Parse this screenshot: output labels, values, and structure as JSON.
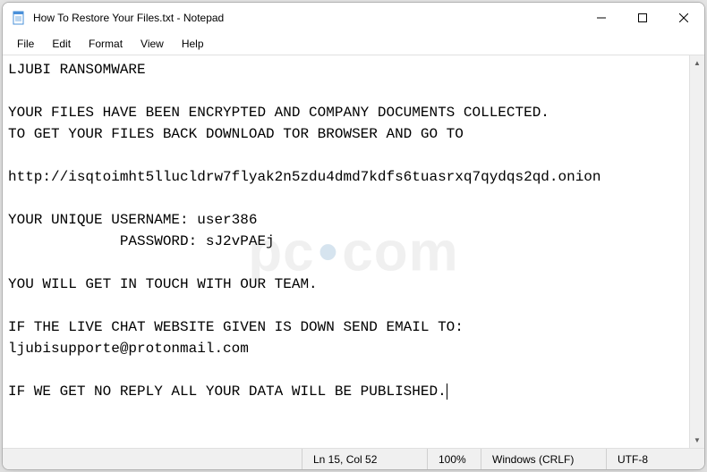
{
  "window": {
    "title": "How To Restore Your Files.txt - Notepad"
  },
  "menubar": {
    "items": [
      "File",
      "Edit",
      "Format",
      "View",
      "Help"
    ]
  },
  "editor": {
    "content": "LJUBI RANSOMWARE\n\nYOUR FILES HAVE BEEN ENCRYPTED AND COMPANY DOCUMENTS COLLECTED.\nTO GET YOUR FILES BACK DOWNLOAD TOR BROWSER AND GO TO\n\nhttp://isqtoimht5llucldrw7flyak2n5zdu4dmd7kdfs6tuasrxq7qydqs2qd.onion\n\nYOUR UNIQUE USERNAME: user386\n             PASSWORD: sJ2vPAEj\n\nYOU WILL GET IN TOUCH WITH OUR TEAM.\n\nIF THE LIVE CHAT WEBSITE GIVEN IS DOWN SEND EMAIL TO:\nljubisupporte@protonmail.com\n\nIF WE GET NO REPLY ALL YOUR DATA WILL BE PUBLISHED."
  },
  "statusbar": {
    "position": "Ln 15, Col 52",
    "zoom": "100%",
    "line_ending": "Windows (CRLF)",
    "encoding": "UTF-8"
  },
  "watermark": {
    "text_prefix": "pc",
    "text_suffix": "com",
    "dot": "•"
  }
}
